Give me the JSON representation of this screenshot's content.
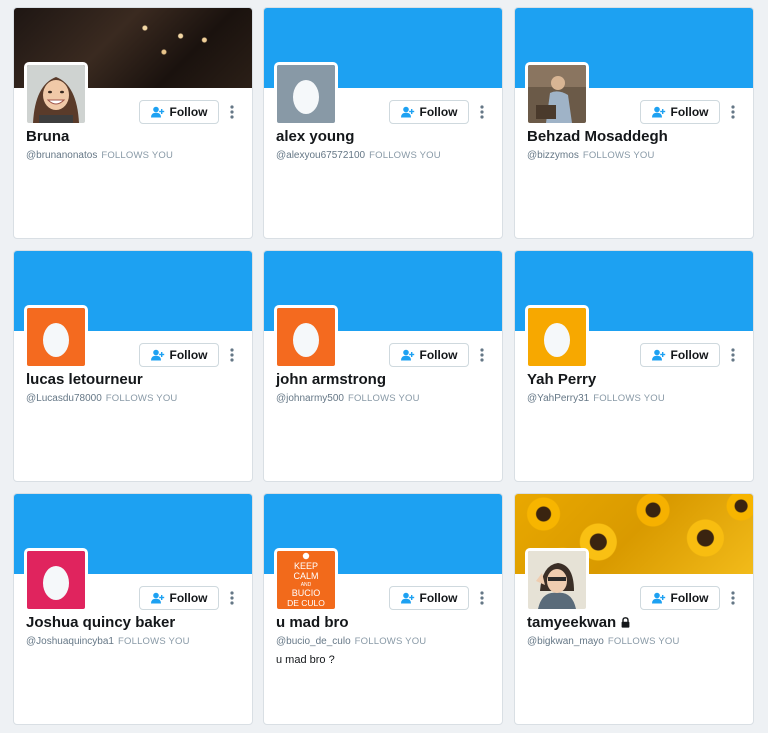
{
  "colors": {
    "twitter_blue": "#1da1f2",
    "egg_gray": "#8899a6",
    "egg_orange": "#f46a1f",
    "egg_amber": "#f7a800",
    "egg_pink": "#e0245e",
    "egg_white": "#f5f8fa"
  },
  "follow_label": "Follow",
  "follows_you_label": "FOLLOWS YOU",
  "cards": [
    {
      "name": "Bruna",
      "handle": "@brunanonatos",
      "banner": "photo",
      "avatar": "photo-woman-smiling",
      "verified_lock": false,
      "bio": ""
    },
    {
      "name": "alex young",
      "handle": "@alexyou67572100",
      "banner": "blue",
      "avatar": "egg-gray",
      "verified_lock": false,
      "bio": ""
    },
    {
      "name": "Behzad Mosaddegh",
      "handle": "@bizzymos",
      "banner": "blue",
      "avatar": "photo-man",
      "verified_lock": false,
      "bio": ""
    },
    {
      "name": "lucas letourneur",
      "handle": "@Lucasdu78000",
      "banner": "blue",
      "avatar": "egg-orange",
      "verified_lock": false,
      "bio": ""
    },
    {
      "name": "john armstrong",
      "handle": "@johnarmy500",
      "banner": "blue",
      "avatar": "egg-orange",
      "verified_lock": false,
      "bio": ""
    },
    {
      "name": "Yah Perry",
      "handle": "@YahPerry31",
      "banner": "blue",
      "avatar": "egg-amber",
      "verified_lock": false,
      "bio": ""
    },
    {
      "name": "Joshua quincy baker",
      "handle": "@Joshuaquincyba1",
      "banner": "blue",
      "avatar": "egg-pink",
      "verified_lock": false,
      "bio": ""
    },
    {
      "name": "u mad bro",
      "handle": "@bucio_de_culo",
      "banner": "blue",
      "avatar": "keep-calm-poster",
      "verified_lock": false,
      "bio": "u mad bro ?",
      "avatar_text": [
        "KEEP",
        "CALM",
        "AND",
        "BUCIO",
        "DE CULO"
      ]
    },
    {
      "name": "tamyeekwan",
      "handle": "@bigkwan_mayo",
      "banner": "sunflowers",
      "avatar": "photo-person",
      "verified_lock": true,
      "bio": ""
    }
  ]
}
